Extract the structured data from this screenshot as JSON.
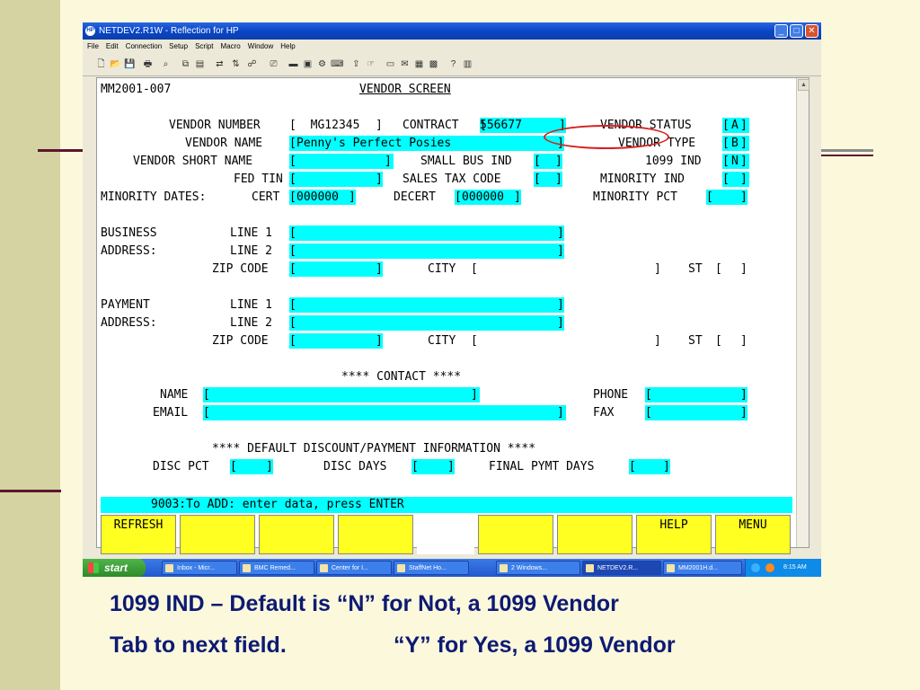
{
  "window": {
    "title": "NETDEV2.R1W - Reflection for HP",
    "app_icon": "HP",
    "controls": {
      "minimize": "_",
      "maximize": "□",
      "close": "✕"
    }
  },
  "menu": [
    "File",
    "Edit",
    "Connection",
    "Setup",
    "Script",
    "Macro",
    "Window",
    "Help"
  ],
  "screen": {
    "screen_id": "MM2001-007",
    "title": "VENDOR SCREEN",
    "vendor_number": {
      "label": "VENDOR NUMBER",
      "value": "  MG12345"
    },
    "contract": {
      "label": "CONTRACT",
      "value": "556677  "
    },
    "vendor_status": {
      "label": "VENDOR STATUS",
      "value": "A"
    },
    "vendor_name": {
      "label": "VENDOR NAME",
      "value": "Penny's Perfect Posies"
    },
    "vendor_type": {
      "label": "VENDOR TYPE",
      "value": "B"
    },
    "vendor_short_name": {
      "label": "VENDOR SHORT NAME",
      "value": ""
    },
    "small_bus_ind": {
      "label": "SMALL BUS IND",
      "value": " "
    },
    "ind_1099": {
      "label": "1099 IND",
      "value": "N"
    },
    "fed_tin": {
      "label": "FED TIN",
      "value": ""
    },
    "sales_tax_code": {
      "label": "SALES TAX CODE",
      "value": " "
    },
    "minority_ind": {
      "label": "MINORITY IND",
      "value": " "
    },
    "minority_dates": {
      "label": "MINORITY DATES:",
      "cert_label": "CERT",
      "cert_value": "000000",
      "decert_label": "DECERT",
      "decert_value": "000000"
    },
    "minority_pct": {
      "label": "MINORITY PCT",
      "value": ""
    },
    "business_address": {
      "label1": "BUSINESS",
      "label2": "ADDRESS:",
      "line1_label": "LINE 1",
      "line2_label": "LINE 2",
      "line1_value": "",
      "line2_value": "",
      "zip_label": "ZIP CODE",
      "zip_value": "",
      "city_label": "CITY",
      "city_value": "",
      "st_label": "ST",
      "st_value": ""
    },
    "payment_address": {
      "label1": "PAYMENT",
      "label2": "ADDRESS:",
      "line1_label": "LINE 1",
      "line2_label": "LINE 2",
      "line1_value": "",
      "line2_value": "",
      "zip_label": "ZIP CODE",
      "zip_value": "",
      "city_label": "CITY",
      "city_value": "",
      "st_label": "ST",
      "st_value": ""
    },
    "contact_header": "**** CONTACT ****",
    "contact": {
      "name_label": "NAME",
      "name_value": "",
      "email_label": "EMAIL",
      "email_value": "",
      "phone_label": "PHONE",
      "phone_value": "",
      "fax_label": "FAX",
      "fax_value": ""
    },
    "discount_header": "**** DEFAULT DISCOUNT/PAYMENT INFORMATION ****",
    "discount": {
      "disc_pct_label": "DISC PCT",
      "disc_pct_value": "",
      "disc_days_label": "DISC DAYS",
      "disc_days_value": "",
      "final_pymt_label": "FINAL PYMT DAYS",
      "final_pymt_value": ""
    },
    "status_message": "9003:To ADD: enter data, press ENTER"
  },
  "function_keys": [
    "REFRESH",
    "",
    "",
    "",
    "",
    "",
    "",
    "HELP",
    "MENU"
  ],
  "taskbar": {
    "start_label": "start",
    "tasks": [
      "Inbox - Micr...",
      "BMC Remed...",
      "Center for I...",
      "StaffNet Ho...",
      "2 Windows...",
      "NETDEV2.R...",
      "MM2001H.d..."
    ],
    "clock": "8:15 AM"
  },
  "caption": {
    "line1": "1099 IND – Default is “N” for Not, a 1099 Vendor",
    "line2_left": "Tab to next field.",
    "line2_right": "“Y” for Yes, a 1099 Vendor"
  },
  "colors": {
    "field": "#00ffff",
    "fkey": "#ffff22",
    "caption": "#0d1a73",
    "highlight": "#d62020"
  }
}
